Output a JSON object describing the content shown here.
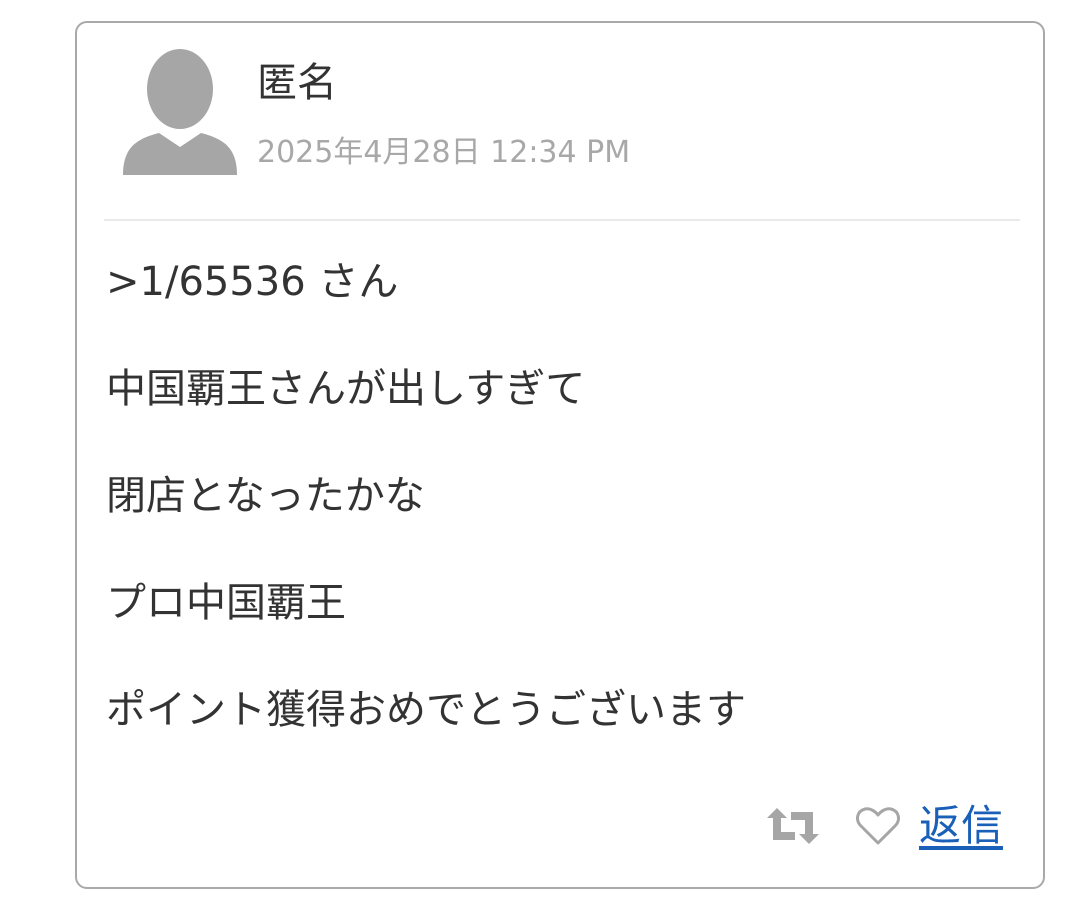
{
  "post": {
    "author": "匿名",
    "timestamp": "2025年4月28日 12:34 PM",
    "lines": [
      ">1/65536 さん",
      "中国覇王さんが出しすぎて",
      "閉店となったかな",
      "プロ中国覇王",
      "ポイント獲得おめでとうございます"
    ]
  },
  "actions": {
    "retweet_icon": "retweet-icon",
    "like_icon": "heart-outline-icon",
    "reply_label": "返信"
  },
  "colors": {
    "border": "#a9a9a9",
    "avatar": "#a6a6a6",
    "timestamp": "#a8a8a8",
    "text": "#333333",
    "link": "#1a5fb8",
    "icon": "#a6a6a6"
  }
}
